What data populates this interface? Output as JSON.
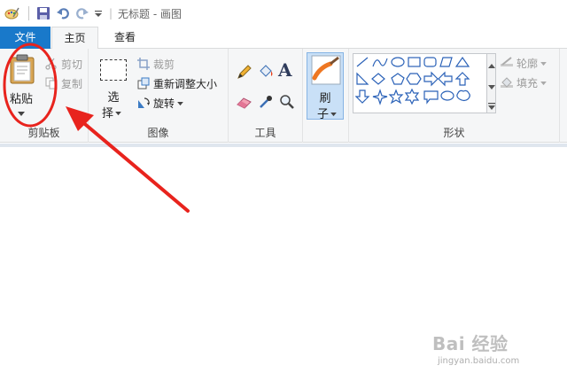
{
  "titlebar": {
    "separator": "|",
    "title": "无标题 - 画图"
  },
  "tabs": {
    "file": "文件",
    "home": "主页",
    "view": "查看"
  },
  "ribbon": {
    "clipboard": {
      "paste": "粘贴",
      "cut": "剪切",
      "copy": "复制",
      "label": "剪贴板"
    },
    "image": {
      "select_top": "选",
      "select_bottom": "择",
      "crop": "裁剪",
      "resize": "重新调整大小",
      "rotate": "旋转",
      "label": "图像"
    },
    "tools": {
      "label": "工具"
    },
    "brush": {
      "top": "刷",
      "bottom": "子"
    },
    "shapes": {
      "outline": "轮廓",
      "fill": "填充",
      "label": "形状"
    }
  },
  "watermark": {
    "brand": "Bai 经验",
    "url": "jingyan.baidu.com"
  },
  "colors": {
    "file_tab": "#1979ca",
    "ribbon_bg": "#f5f6f7",
    "annotation_red": "#e8231d",
    "brush_highlight": "#c9e0f7"
  }
}
